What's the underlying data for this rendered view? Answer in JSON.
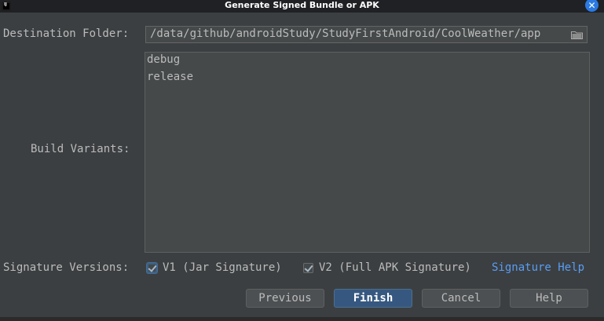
{
  "window": {
    "title": "Generate Signed Bundle or APK",
    "app_icon": "android-studio-icon",
    "close_icon": "close-icon",
    "close_glyph": "✕"
  },
  "app_icon_text": "IJ",
  "destination": {
    "label": "Destination Folder:",
    "value": "/data/github/androidStudy/StudyFirstAndroid/CoolWeather/app",
    "browse_icon": "folder-icon"
  },
  "build_variants": {
    "label": "Build Variants:",
    "items": [
      "debug",
      "release"
    ]
  },
  "signature": {
    "label": "Signature Versions:",
    "v1_label": "V1 (Jar Signature)",
    "v1_checked": true,
    "v2_label": "V2 (Full APK Signature)",
    "v2_checked": true,
    "help_link": "Signature Help"
  },
  "buttons": {
    "previous": "Previous",
    "finish": "Finish",
    "cancel": "Cancel",
    "help": "Help"
  },
  "colors": {
    "background": "#3c3f41",
    "titlebar": "#1f2124",
    "accent": "#365880",
    "link": "#589df6",
    "close": "#2a7ae2"
  }
}
